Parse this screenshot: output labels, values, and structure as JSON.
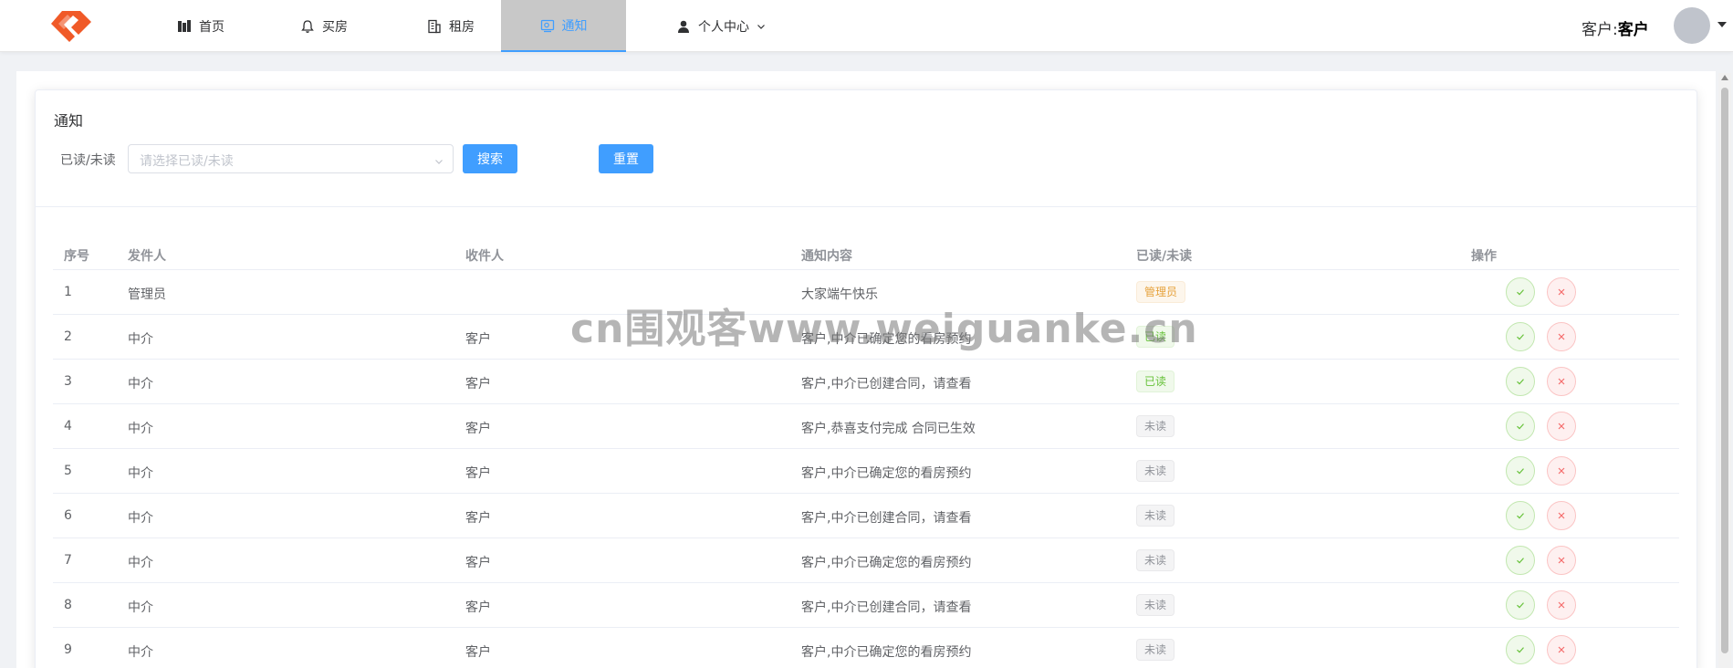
{
  "nav": {
    "items": [
      {
        "label": "首页",
        "icon": "building-icon"
      },
      {
        "label": "买房",
        "icon": "bell-icon"
      },
      {
        "label": "租房",
        "icon": "office-icon"
      },
      {
        "label": "通知",
        "icon": "message-icon"
      },
      {
        "label": "个人中心",
        "icon": "user-icon"
      }
    ],
    "active": "通知",
    "user_prefix": "客户:",
    "user_name": "客户"
  },
  "page": {
    "title": "通知",
    "filter_label": "已读/未读",
    "select_placeholder": "请选择已读/未读",
    "search_label": "搜索",
    "reset_label": "重置"
  },
  "table": {
    "headers": [
      "序号",
      "发件人",
      "收件人",
      "通知内容",
      "已读/未读",
      "操作"
    ],
    "rows": [
      {
        "no": "1",
        "sender": "管理员",
        "receiver": "",
        "content": "大家端午快乐",
        "status": "管理员",
        "status_type": "warning"
      },
      {
        "no": "2",
        "sender": "中介",
        "receiver": "客户",
        "content": "客户,中介已确定您的看房预约",
        "status": "已读",
        "status_type": "success"
      },
      {
        "no": "3",
        "sender": "中介",
        "receiver": "客户",
        "content": "客户,中介已创建合同，请查看",
        "status": "已读",
        "status_type": "success"
      },
      {
        "no": "4",
        "sender": "中介",
        "receiver": "客户",
        "content": "客户,恭喜支付完成 合同已生效",
        "status": "未读",
        "status_type": "info"
      },
      {
        "no": "5",
        "sender": "中介",
        "receiver": "客户",
        "content": "客户,中介已确定您的看房预约",
        "status": "未读",
        "status_type": "info"
      },
      {
        "no": "6",
        "sender": "中介",
        "receiver": "客户",
        "content": "客户,中介已创建合同，请查看",
        "status": "未读",
        "status_type": "info"
      },
      {
        "no": "7",
        "sender": "中介",
        "receiver": "客户",
        "content": "客户,中介已确定您的看房预约",
        "status": "未读",
        "status_type": "info"
      },
      {
        "no": "8",
        "sender": "中介",
        "receiver": "客户",
        "content": "客户,中介已创建合同，请查看",
        "status": "未读",
        "status_type": "info"
      },
      {
        "no": "9",
        "sender": "中介",
        "receiver": "客户",
        "content": "客户,中介已确定您的看房预约",
        "status": "未读",
        "status_type": "info"
      }
    ]
  },
  "watermark": "cn围观客www.weiguanke.cn",
  "colors": {
    "primary": "#409eff",
    "success": "#67c23a",
    "danger": "#f56c6c",
    "warning": "#e6a23c"
  }
}
